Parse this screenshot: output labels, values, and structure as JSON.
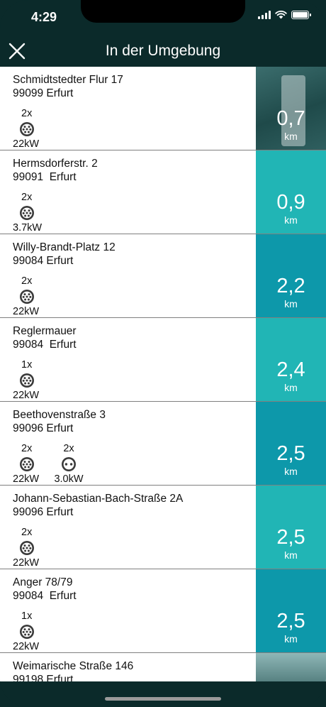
{
  "status": {
    "time": "4:29"
  },
  "nav": {
    "title": "In der Umgebung"
  },
  "colors": {
    "teal_light": "#21b5b5",
    "teal_dark": "#0d98aa",
    "header_bg": "#0b2a2a"
  },
  "stations": [
    {
      "street": "Schmidtstedter Flur 17",
      "city": "99099 Erfurt",
      "connectors": [
        {
          "count": "2x",
          "icon": "type2-plug-icon",
          "power": "22kW"
        }
      ],
      "distance": "0,7",
      "unit": "km",
      "tile": "photo"
    },
    {
      "street": "Hermsdorferstr. 2",
      "city": "99091  Erfurt",
      "connectors": [
        {
          "count": "2x",
          "icon": "type2-plug-icon",
          "power": "3.7kW"
        }
      ],
      "distance": "0,9",
      "unit": "km",
      "tile": "#21b5b5"
    },
    {
      "street": "Willy-Brandt-Platz 12",
      "city": "99084 Erfurt",
      "connectors": [
        {
          "count": "2x",
          "icon": "type2-plug-icon",
          "power": "22kW"
        }
      ],
      "distance": "2,2",
      "unit": "km",
      "tile": "#0d98aa"
    },
    {
      "street": "Reglermauer",
      "city": "99084  Erfurt",
      "connectors": [
        {
          "count": "1x",
          "icon": "type2-plug-icon",
          "power": "22kW"
        }
      ],
      "distance": "2,4",
      "unit": "km",
      "tile": "#21b5b5"
    },
    {
      "street": "Beethovenstraße 3",
      "city": "99096 Erfurt",
      "connectors": [
        {
          "count": "2x",
          "icon": "type2-plug-icon",
          "power": "22kW"
        },
        {
          "count": "2x",
          "icon": "schuko-plug-icon",
          "power": "3.0kW"
        }
      ],
      "distance": "2,5",
      "unit": "km",
      "tile": "#0d98aa"
    },
    {
      "street": "Johann-Sebastian-Bach-Straße 2A",
      "city": "99096 Erfurt",
      "connectors": [
        {
          "count": "2x",
          "icon": "type2-plug-icon",
          "power": "22kW"
        }
      ],
      "distance": "2,5",
      "unit": "km",
      "tile": "#21b5b5"
    },
    {
      "street": "Anger 78/79",
      "city": "99084  Erfurt",
      "connectors": [
        {
          "count": "1x",
          "icon": "type2-plug-icon",
          "power": "22kW"
        }
      ],
      "distance": "2,5",
      "unit": "km",
      "tile": "#0d98aa"
    },
    {
      "street": "Weimarische Straße 146",
      "city": "99198 Erfurt",
      "connectors": [],
      "distance": "",
      "unit": "",
      "tile": "photo2"
    }
  ]
}
